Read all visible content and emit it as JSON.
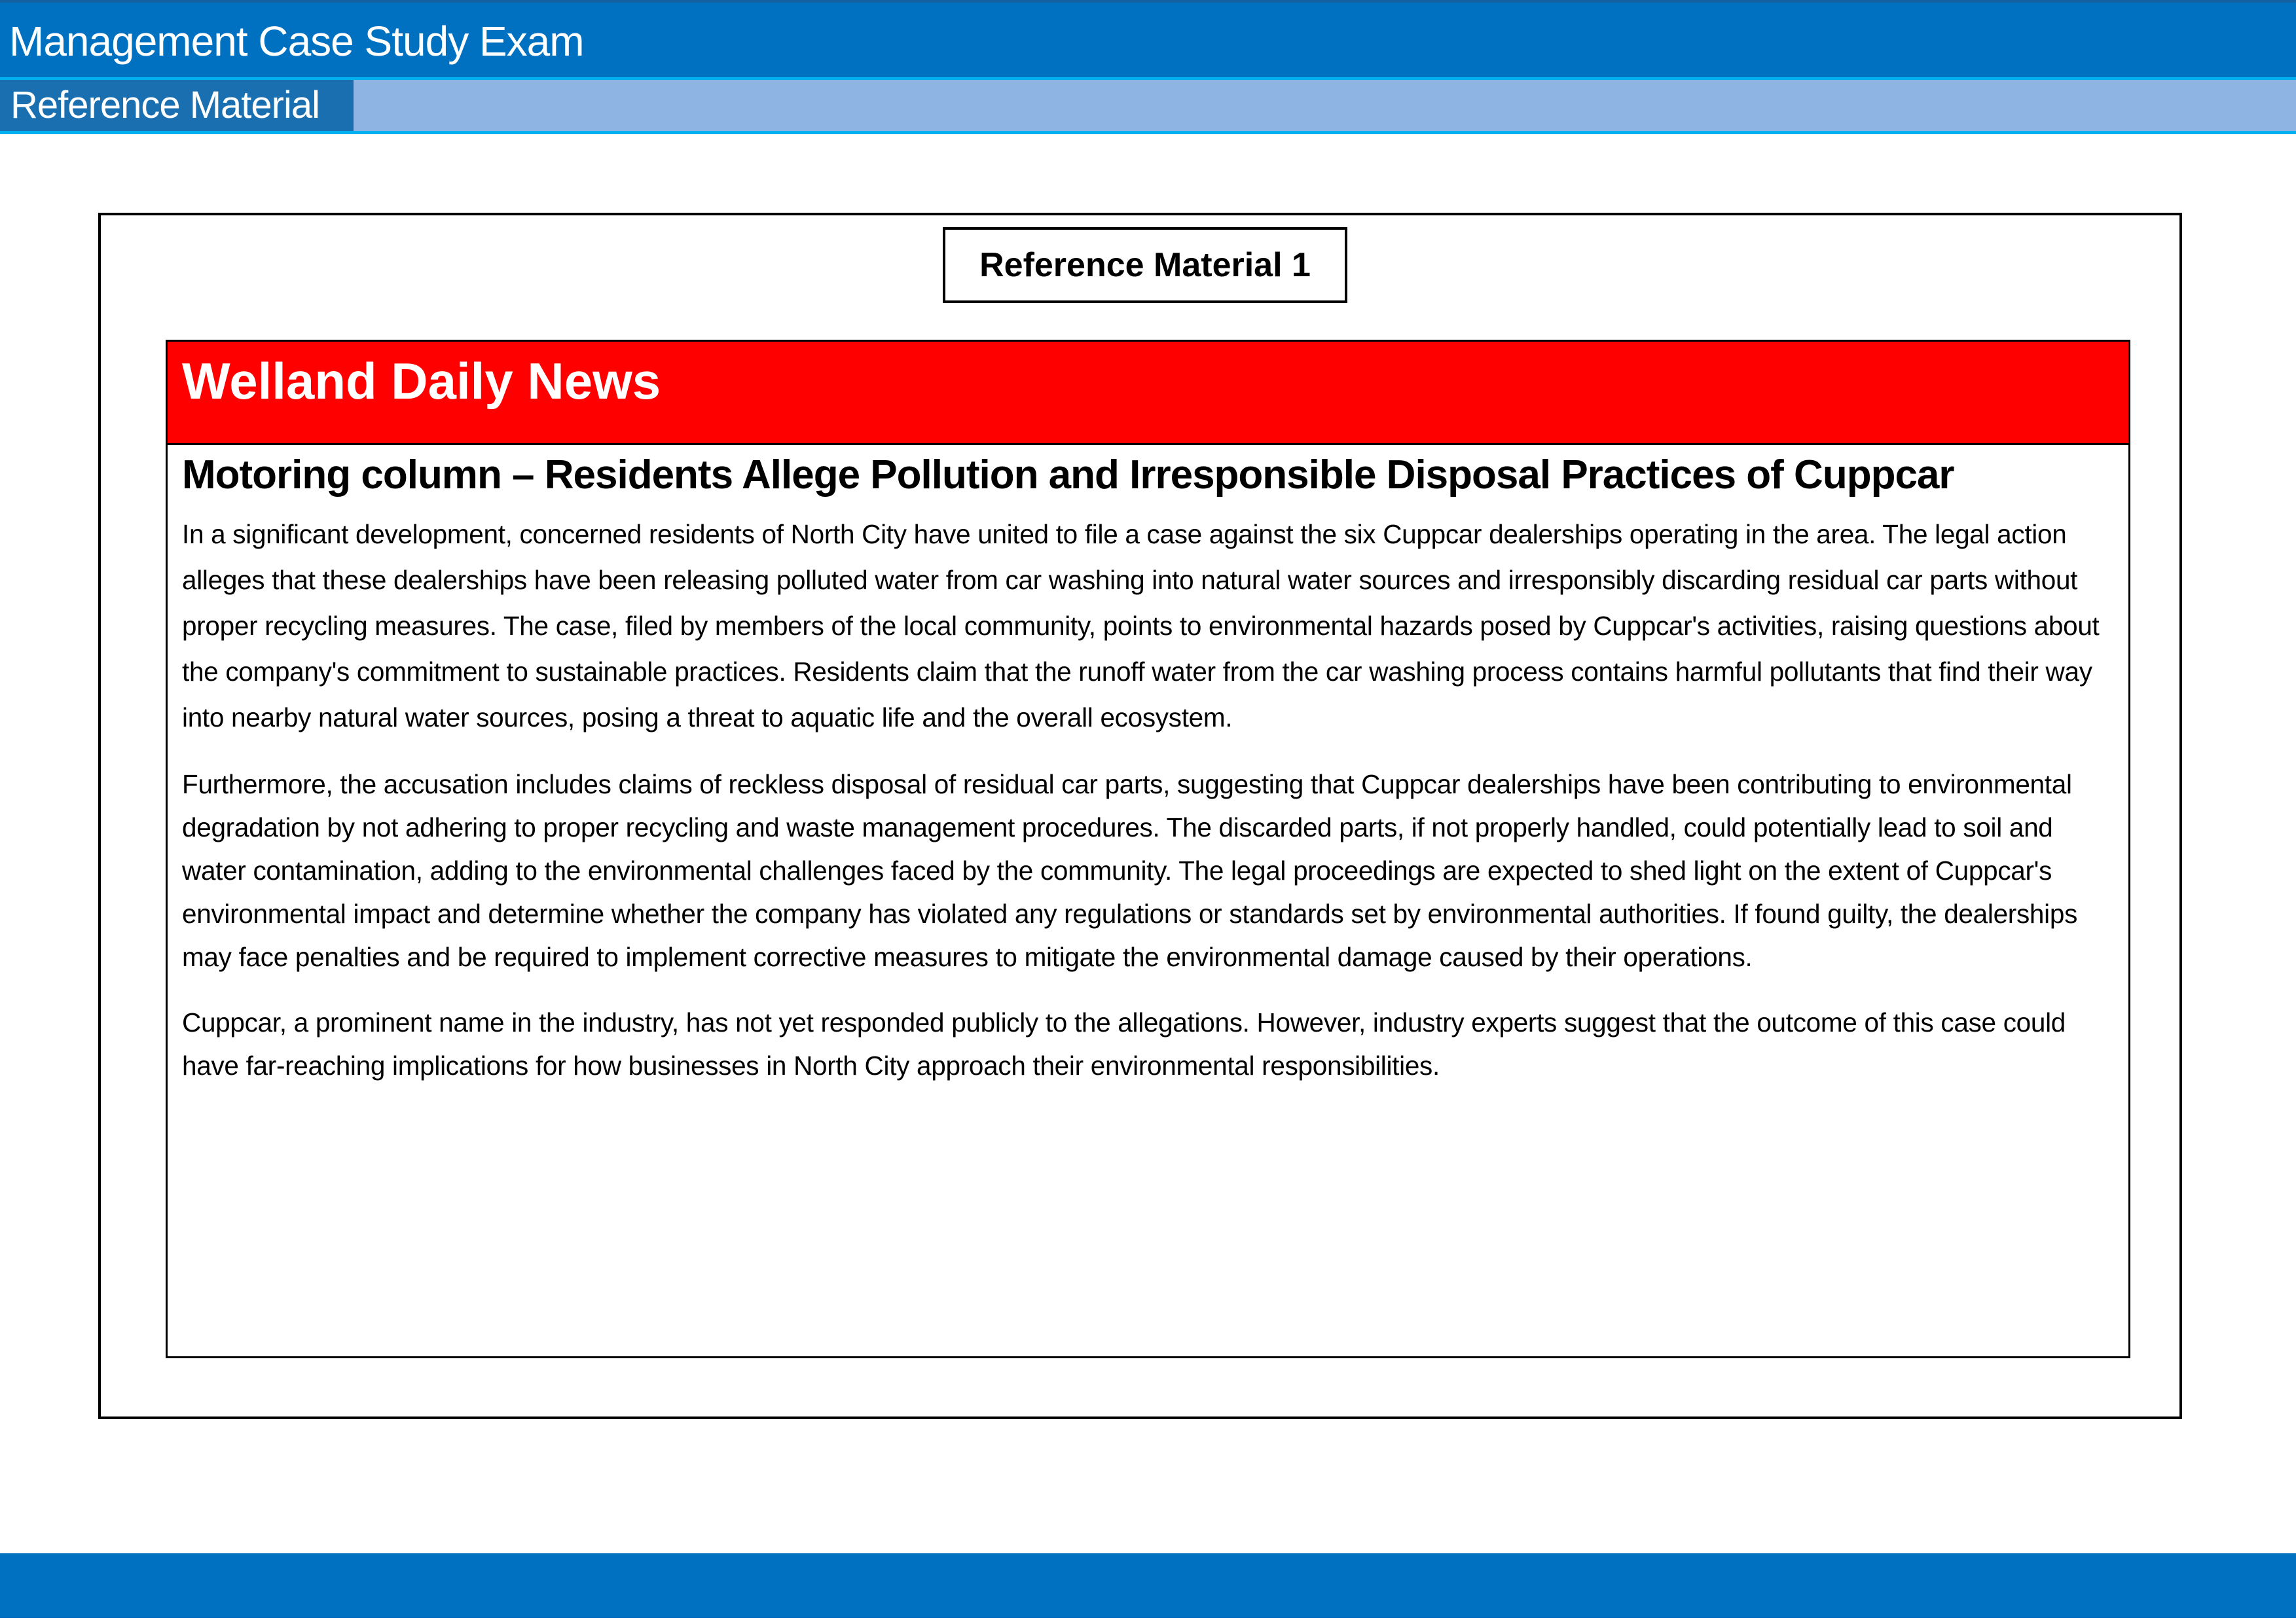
{
  "header": {
    "title": "Management Case Study Exam"
  },
  "tabs": [
    {
      "label": "Reference Material",
      "active": true
    }
  ],
  "reference": {
    "label": "Reference Material 1",
    "masthead": "Welland Daily News",
    "headline": "Motoring column – Residents Allege Pollution and Irresponsible Disposal Practices of Cuppcar",
    "paragraphs": [
      "In a significant development, concerned residents of North City have united to file a case against the six Cuppcar dealerships operating in the area. The legal action alleges that these dealerships have been releasing polluted water from car washing into natural water sources and irresponsibly discarding residual car parts without proper recycling measures. The case, filed by members of the local community, points to environmental hazards posed by Cuppcar's activities, raising questions about the company's commitment to sustainable practices. Residents claim that the runoff water from the car washing process contains harmful pollutants that find their way into nearby natural water sources, posing a threat to aquatic life and the overall ecosystem.",
      "Furthermore, the accusation includes claims of reckless disposal of residual car parts, suggesting that Cuppcar dealerships have been contributing to environmental degradation by not adhering to proper recycling and waste management procedures. The discarded parts, if not properly handled, could potentially lead to soil and water contamination, adding to the environmental challenges faced by the community. The legal proceedings are expected to shed light on the extent of Cuppcar's environmental impact and determine whether the company has violated any regulations or standards set by environmental authorities. If found guilty, the dealerships may face penalties and be required to implement corrective measures to mitigate the environmental damage caused by their operations.",
      "Cuppcar, a prominent name in the industry, has not yet responded publicly to the allegations. However, industry experts suggest that the outcome of this case could have far-reaching implications for how businesses in North City approach their environmental responsibilities."
    ]
  },
  "colors": {
    "primary": "#0070c0",
    "tab_bar": "#8db4e2",
    "accent_line": "#00b0f0",
    "masthead": "#ff0000"
  }
}
